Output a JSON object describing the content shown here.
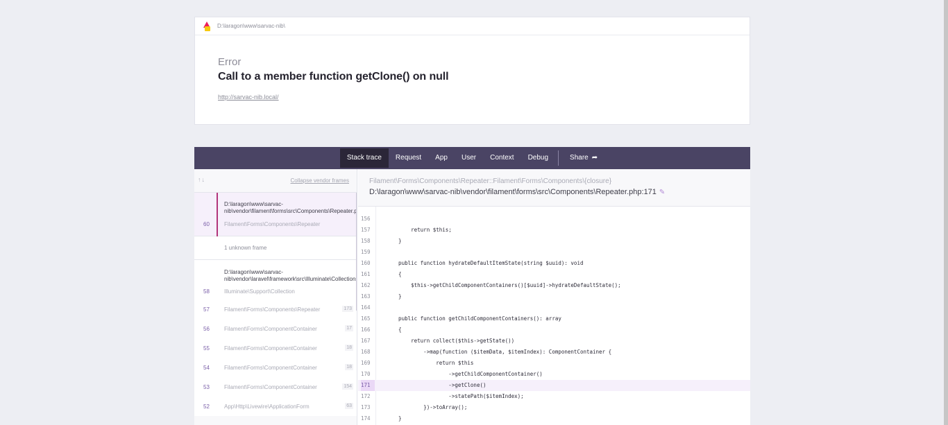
{
  "header": {
    "path": "D:\\laragon\\www\\sarvac-nib\\",
    "error_label": "Error",
    "error_message": "Call to a member function getClone() on null",
    "url": "http://sarvac-nib.local/"
  },
  "tabs": {
    "items": [
      "Stack trace",
      "Request",
      "App",
      "User",
      "Context",
      "Debug"
    ],
    "active": "Stack trace",
    "share": "Share"
  },
  "frames": {
    "collapse_label": "Collapse vendor frames",
    "selected": {
      "file": "D:\\laragon\\www\\sarvac-nib\\vendor\\filament\\forms\\src\\Components\\Repeater.php",
      "file_line1": "D:\\laragon\\www\\sarvac-",
      "file_line2": "nib\\vendor\\filament\\forms\\src\\Components\\Repeater.php",
      "number": "60",
      "class": "Filament\\Forms\\Components\\Repeater"
    },
    "unknown": "1 unknown frame",
    "frame58": {
      "file_line1": "D:\\laragon\\www\\sarvac-",
      "file_line2": "nib\\vendor\\laravel\\framework\\src\\Illuminate\\Collections\\Collection.php",
      "number": "58",
      "class": "Illuminate\\Support\\Collection"
    },
    "rows": [
      {
        "number": "57",
        "class": "Filament\\Forms\\Components\\Repeater",
        "line": "173"
      },
      {
        "number": "56",
        "class": "Filament\\Forms\\ComponentContainer",
        "line": "17"
      },
      {
        "number": "55",
        "class": "Filament\\Forms\\ComponentContainer",
        "line": "18"
      },
      {
        "number": "54",
        "class": "Filament\\Forms\\ComponentContainer",
        "line": "18"
      },
      {
        "number": "53",
        "class": "Filament\\Forms\\ComponentContainer",
        "line": "154"
      },
      {
        "number": "52",
        "class": "App\\Http\\Livewire\\ApplicationForm",
        "line": "63"
      }
    ]
  },
  "code_header": {
    "class": "Filament\\Forms\\Components\\Repeater::Filament\\Forms\\Components\\{closure}",
    "file": "D:\\laragon\\www\\sarvac-nib\\vendor\\filament\\forms\\src\\Components\\Repeater.php:171"
  },
  "code": {
    "highlight_line": "171",
    "lines": [
      {
        "n": "156",
        "t": ""
      },
      {
        "n": "157",
        "t": "        return $this;"
      },
      {
        "n": "158",
        "t": "    }"
      },
      {
        "n": "159",
        "t": ""
      },
      {
        "n": "160",
        "t": "    public function hydrateDefaultItemState(string $uuid): void"
      },
      {
        "n": "161",
        "t": "    {"
      },
      {
        "n": "162",
        "t": "        $this->getChildComponentContainers()[$uuid]->hydrateDefaultState();"
      },
      {
        "n": "163",
        "t": "    }"
      },
      {
        "n": "164",
        "t": ""
      },
      {
        "n": "165",
        "t": "    public function getChildComponentContainers(): array"
      },
      {
        "n": "166",
        "t": "    {"
      },
      {
        "n": "167",
        "t": "        return collect($this->getState())"
      },
      {
        "n": "168",
        "t": "            ->map(function ($itemData, $itemIndex): ComponentContainer {"
      },
      {
        "n": "169",
        "t": "                return $this"
      },
      {
        "n": "170",
        "t": "                    ->getChildComponentContainer()"
      },
      {
        "n": "171",
        "t": "                    ->getClone()"
      },
      {
        "n": "172",
        "t": "                    ->statePath($itemIndex);"
      },
      {
        "n": "173",
        "t": "            })->toArray();"
      },
      {
        "n": "174",
        "t": "    }"
      }
    ]
  }
}
